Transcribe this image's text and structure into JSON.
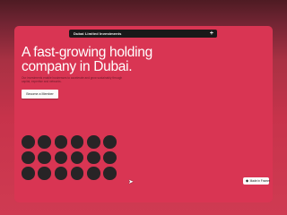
{
  "colors": {
    "page_background": "#b8303f",
    "card_background": "#d93553",
    "navbar_background": "#191919",
    "circle_fill": "#282426",
    "cta_background": "#fbfbfb"
  },
  "navbar": {
    "title": "Dubai Limited Investments",
    "menu_icon": "plus-icon"
  },
  "hero": {
    "headline_line1": "A fast-growing holding",
    "headline_line2": "company in Dubai.",
    "subtext": "Our investments enable businesses to accelerate and grow sustainably through capital, expertise and networks.",
    "cta_label": "Become a Member"
  },
  "circle_grid": {
    "rows": 3,
    "columns": 6
  },
  "badge": {
    "icon": "framer-icon",
    "label": "Made in Framer"
  },
  "cursor": {
    "icon": "pointer-cursor-icon"
  }
}
